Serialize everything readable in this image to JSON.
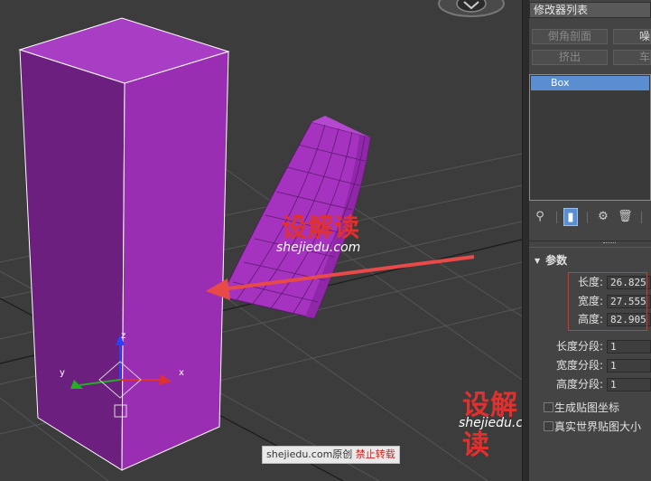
{
  "panel": {
    "modifier_list": "修改器列表",
    "buttons": {
      "chamfer_profile": "倒角剖面",
      "noise": "噪",
      "extrude": "挤出",
      "lathe": "车"
    },
    "stack": {
      "selected_item": "Box"
    },
    "toolbar": {
      "pin_icon": "pin-icon",
      "show_end_icon": "show-end-result-icon",
      "unique_icon": "make-unique-icon",
      "remove_icon": "trash-icon",
      "config_icon": "configure-icon"
    },
    "parameters": {
      "title": "参数",
      "length_label": "长度:",
      "length_value": "26.825",
      "width_label": "宽度:",
      "width_value": "27.555",
      "height_label": "高度:",
      "height_value": "82.905",
      "length_segs_label": "长度分段:",
      "length_segs_value": "1",
      "width_segs_label": "宽度分段:",
      "width_segs_value": "1",
      "height_segs_label": "高度分段:",
      "height_segs_value": "1",
      "gen_map_coords": "生成贴图坐标",
      "real_world_map": "真实世界贴图大小"
    }
  },
  "viewport": {
    "gizmo_x": "x",
    "gizmo_y": "y",
    "gizmo_z": "z",
    "colors": {
      "box_front": "#9a2eb3",
      "box_side": "#6d1f80",
      "box_top": "#a83ec4",
      "arrow": "#e84a4a"
    }
  },
  "watermark": {
    "logo": "设解读",
    "url": "shejiedu.com",
    "credit_site": "shejiedu.com原创",
    "credit_notice": "禁止转载"
  }
}
